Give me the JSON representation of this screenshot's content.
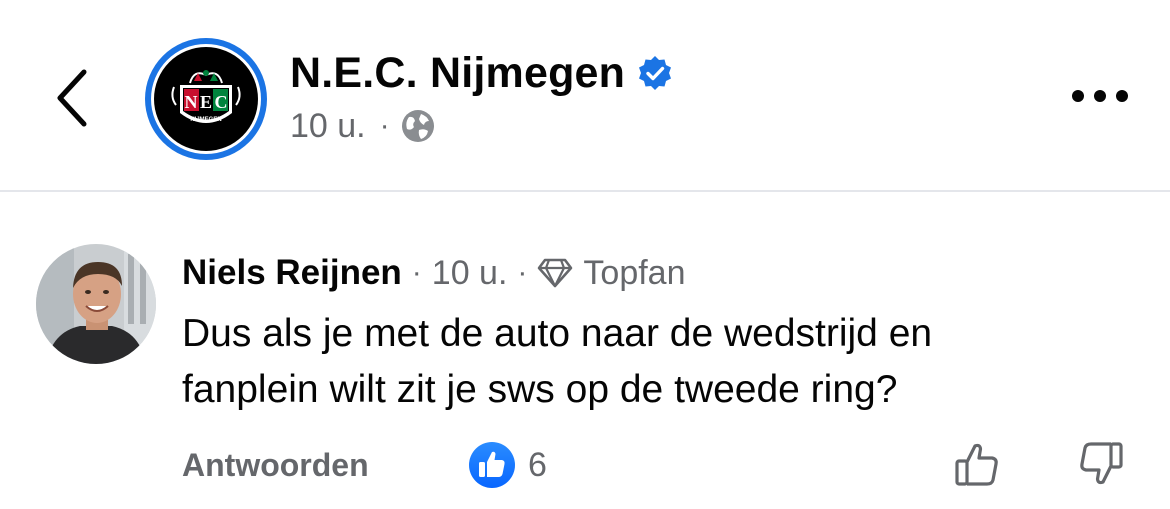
{
  "header": {
    "page_name": "N.E.C. Nijmegen",
    "time": "10 u.",
    "dot": "·",
    "logo": {
      "letters": [
        "N",
        "E",
        "C"
      ],
      "sublabel": "NIJMEGEN"
    },
    "icons": {
      "back": "chevron-left-icon",
      "verified": "verified-badge-icon",
      "audience": "globe-icon",
      "more": "more-horizontal-icon"
    }
  },
  "comment": {
    "author": "Niels Reijnen",
    "sep1": "·",
    "time": "10 u.",
    "sep2": "·",
    "badge_label": "Topfan",
    "text_lines": [
      "Dus als je met de auto naar de wedstrijd en",
      "fanplein wilt zit je sws op de tweede ring?"
    ],
    "reply_label": "Antwoorden",
    "like_count": "6"
  },
  "colors": {
    "accent": "#1b74e4",
    "muted": "#65676b",
    "text": "#050505",
    "divider": "#e4e6eb",
    "nec_red": "#c8102e",
    "nec_green": "#00843d"
  }
}
